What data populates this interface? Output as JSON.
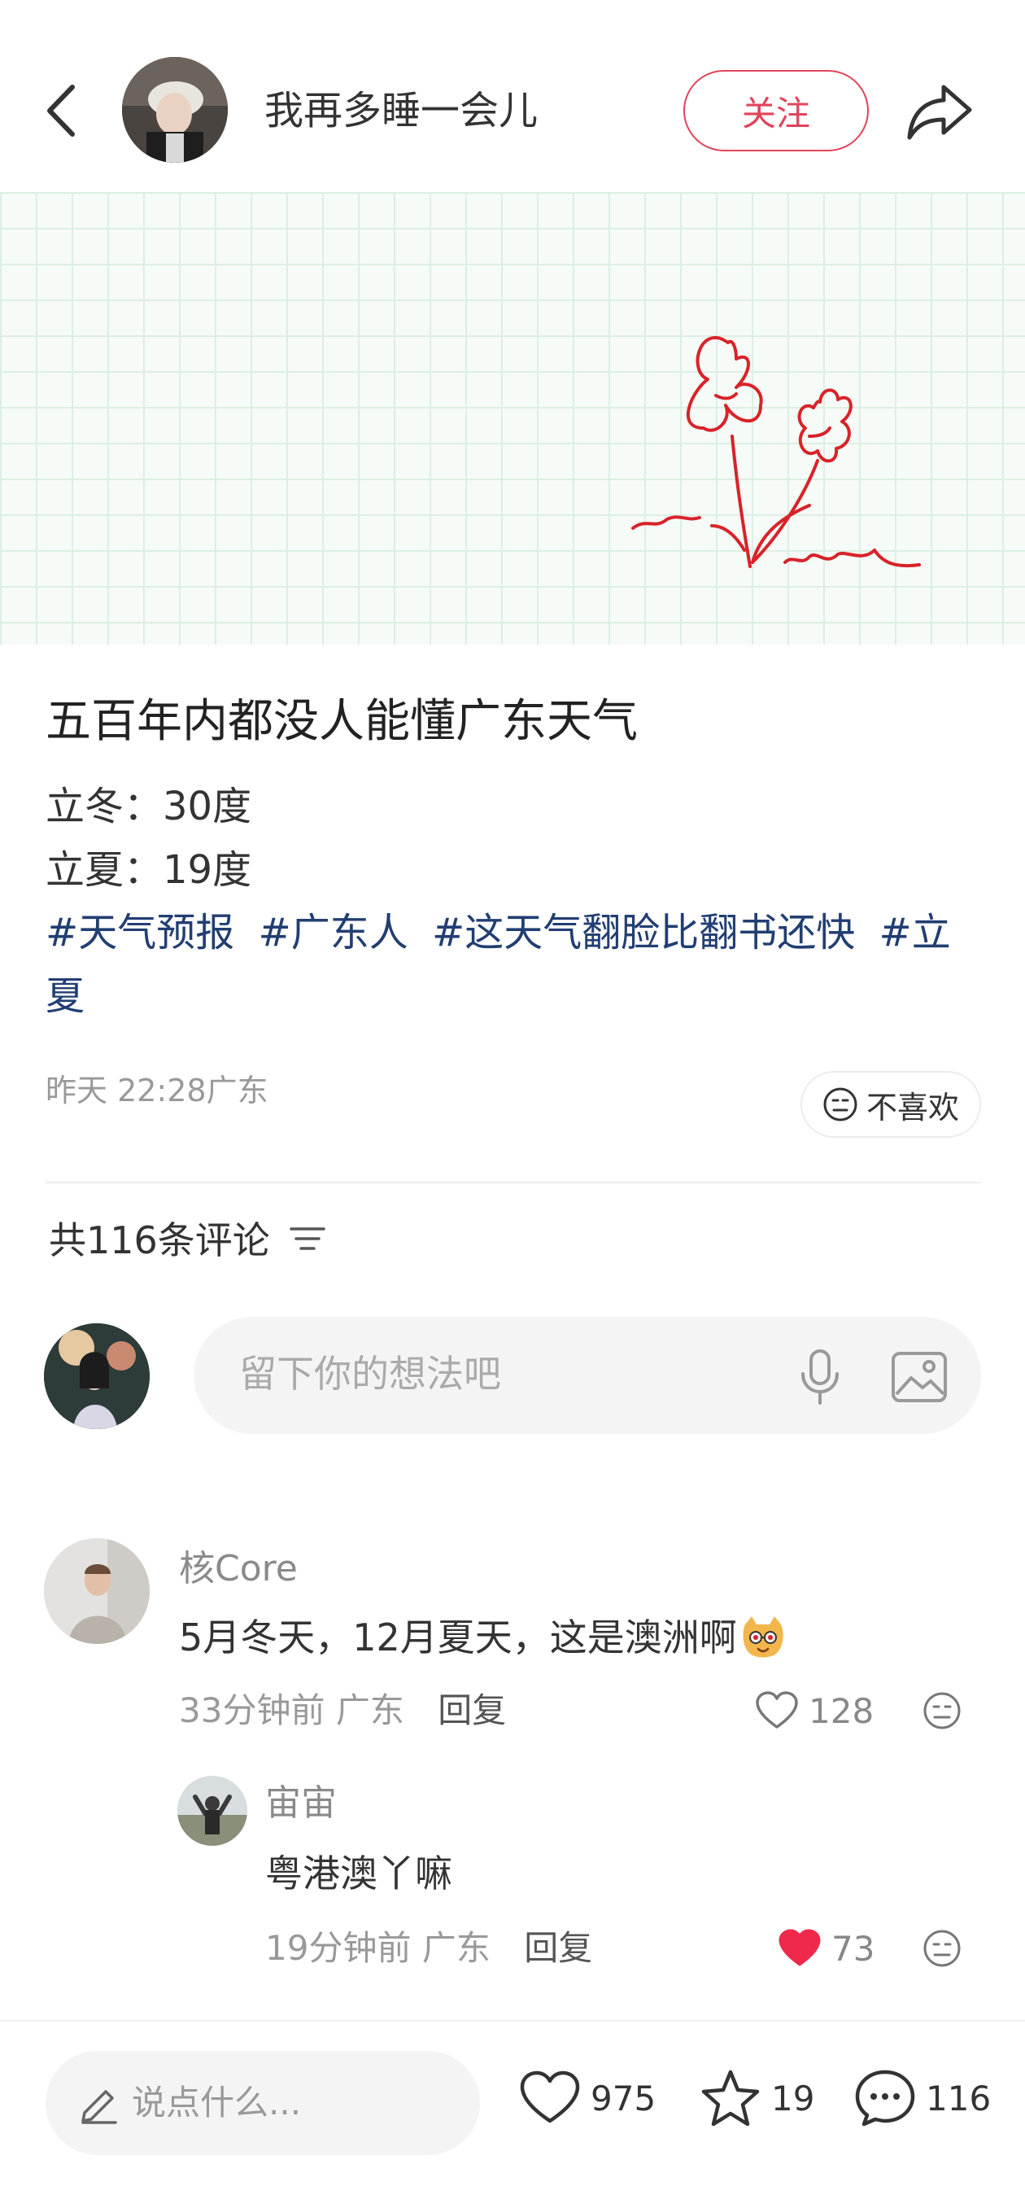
{
  "header": {
    "author_name": "我再多睡一会儿",
    "follow_label": "关注"
  },
  "note": {
    "title": "五百年内都没人能懂广东天气",
    "body_lines": [
      "立冬：30度",
      "立夏：19度"
    ],
    "tags": [
      "#天气预报",
      "#广东人",
      "#这天气翻脸比翻书还快",
      "#立夏"
    ],
    "time": "昨天 22:28",
    "location": "广东",
    "dislike_label": "不喜欢"
  },
  "comments_section": {
    "count_label": "共116条评论",
    "input_placeholder": "留下你的想法吧"
  },
  "comments": [
    {
      "name": "核Core",
      "text": "5月冬天，12月夏天，这是澳洲啊",
      "time": "33分钟前",
      "location": "广东",
      "reply_label": "回复",
      "likes": "128",
      "liked": false
    },
    {
      "name": "宙宙",
      "text": "粤港澳丫嘛",
      "time": "19分钟前",
      "location": "广东",
      "reply_label": "回复",
      "likes": "73",
      "liked": true
    }
  ],
  "bottom_bar": {
    "say_placeholder": "说点什么...",
    "likes": "975",
    "collects": "19",
    "comments": "116"
  },
  "colors": {
    "accent": "#e0445a",
    "like_active": "#f0284a",
    "tag": "#223e72",
    "grid": "#dcefe3",
    "doodle": "#d8232a"
  },
  "icons": {
    "back": "chevron-left-icon",
    "share": "share-arrow-icon",
    "dislike": "meh-face-icon",
    "sort": "sort-lines-icon",
    "mic": "microphone-icon",
    "image": "image-icon",
    "like": "heart-icon",
    "collect": "star-icon",
    "comment": "chat-bubble-icon",
    "pencil": "pencil-icon"
  }
}
